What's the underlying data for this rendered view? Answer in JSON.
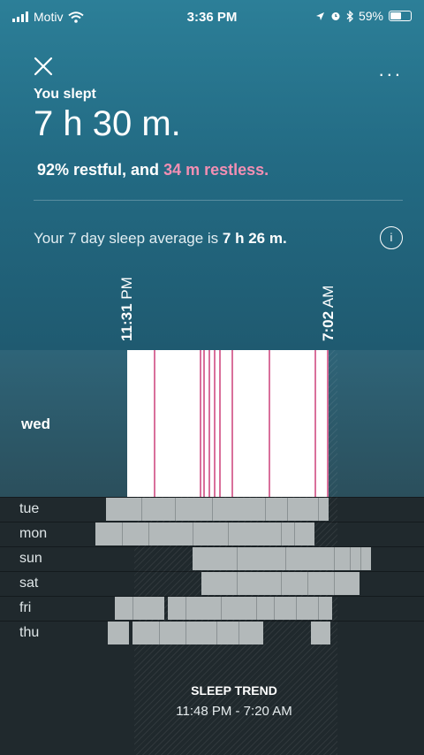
{
  "status_bar": {
    "carrier": "Motiv",
    "time": "3:36 PM",
    "battery": "59%",
    "battery_level": 0.59,
    "icons": [
      "signal-icon",
      "wifi-icon",
      "location-icon",
      "alarm-icon",
      "bluetooth-icon",
      "battery-icon"
    ]
  },
  "header": {
    "close_icon": "close-icon",
    "more_icon": "more-icon",
    "more_label": "...",
    "slept_label": "You slept",
    "slept_value": "7 h 30 m.",
    "restful": "92% restful, and",
    "restless": "34 m restless.",
    "average_prefix": "Your 7 day sleep average is",
    "average_value": "7 h 26 m.",
    "info_label": "i"
  },
  "timeline": {
    "start": {
      "time": "11:31",
      "ampm": "PM"
    },
    "end": {
      "time": "7:02",
      "ampm": "AM"
    }
  },
  "current_day": {
    "label": "wed",
    "restless_marks": 10
  },
  "days": [
    {
      "label": "tue"
    },
    {
      "label": "mon"
    },
    {
      "label": "sun"
    },
    {
      "label": "sat"
    },
    {
      "label": "fri"
    },
    {
      "label": "thu"
    }
  ],
  "trend": {
    "title": "SLEEP TREND",
    "range": "11:48 PM - 7:20 AM"
  },
  "colors": {
    "header_top": "#2c7f98",
    "header_bottom": "#1f5a70",
    "restless": "#f38fb3",
    "bar": "#b3b9ba",
    "background": "#20292d"
  }
}
